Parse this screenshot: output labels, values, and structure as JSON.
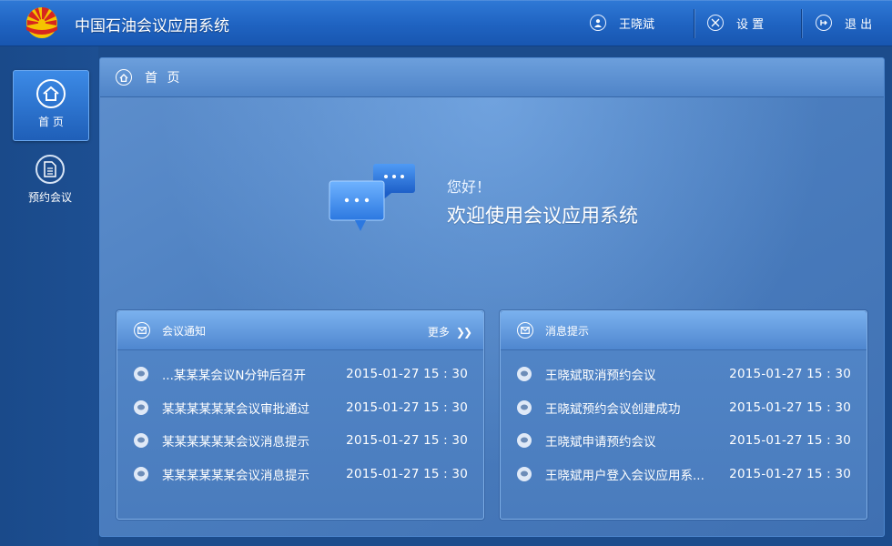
{
  "app": {
    "title": "中国石油会议应用系统"
  },
  "topbar": {
    "user_name": "王晓斌",
    "settings_label": "设 置",
    "logout_label": "退 出"
  },
  "sidebar": {
    "items": [
      {
        "label": "首 页",
        "icon": "home-icon",
        "active": true
      },
      {
        "label": "预约会议",
        "icon": "document-icon",
        "active": false
      }
    ]
  },
  "breadcrumb": {
    "label": "首 页"
  },
  "welcome": {
    "greeting": "您好！",
    "message": "欢迎使用会议应用系统"
  },
  "notice_panel": {
    "title": "会议通知",
    "more_label": "更多",
    "items": [
      {
        "text": "...某某某会议N分钟后召开",
        "time": "2015-01-27   15 : 30"
      },
      {
        "text": "某某某某某某会议审批通过",
        "time": "2015-01-27   15 : 30"
      },
      {
        "text": "某某某某某某会议消息提示",
        "time": "2015-01-27   15 : 30"
      },
      {
        "text": "某某某某某某会议消息提示",
        "time": "2015-01-27   15 : 30"
      }
    ]
  },
  "message_panel": {
    "title": "消息提示",
    "items": [
      {
        "text": "王晓斌取消预约会议",
        "time": "2015-01-27   15 : 30"
      },
      {
        "text": "王晓斌预约会议创建成功",
        "time": "2015-01-27   15 : 30"
      },
      {
        "text": "王晓斌申请预约会议",
        "time": "2015-01-27   15 : 30"
      },
      {
        "text": "王晓斌用户登入会议应用系...",
        "time": "2015-01-27   15 : 30"
      }
    ]
  },
  "colors": {
    "topbar": "#1f63c1",
    "sidebar": "#1c4c8c",
    "panel": "#4c7fc0",
    "logo_red": "#d7261e",
    "logo_yellow": "#f5c400"
  }
}
